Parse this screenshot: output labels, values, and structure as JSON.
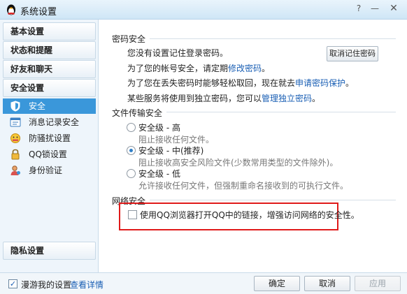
{
  "window": {
    "title": "系统设置",
    "help_label": "?",
    "minimize_label": "—",
    "close_label": "✕"
  },
  "sidebar": {
    "categories": [
      "基本设置",
      "状态和提醒",
      "好友和聊天",
      "安全设置",
      "隐私设置"
    ],
    "security_items": [
      {
        "label": "安全",
        "icon": "shield-icon",
        "active": true
      },
      {
        "label": "消息记录安全",
        "icon": "message-log-icon"
      },
      {
        "label": "防骚扰设置",
        "icon": "anti-harass-icon"
      },
      {
        "label": "QQ锁设置",
        "icon": "lock-icon"
      },
      {
        "label": "身份验证",
        "icon": "identity-icon"
      }
    ]
  },
  "password": {
    "heading": "密码安全",
    "line1": "您没有设置记住登录密码。",
    "cancel_remember_btn": "取消记住密码",
    "line2_prefix": "为了您的帐号安全，请定期",
    "line2_link": "修改密码",
    "line2_suffix": "。",
    "line3_prefix": "为了您在丢失密码时能够轻松取回，现在就去",
    "line3_link": "申请密码保护",
    "line3_suffix": "。",
    "line4_prefix": "某些服务将使用到独立密码，您可以",
    "line4_link": "管理独立密码",
    "line4_suffix": "。"
  },
  "file_transfer": {
    "heading": "文件传输安全",
    "options": [
      {
        "label": "安全级 - 高",
        "desc": "阻止接收任何文件。",
        "checked": false
      },
      {
        "label": "安全级 - 中(推荐)",
        "desc": "阻止接收高安全风险文件(少数常用类型的文件除外)。",
        "checked": true
      },
      {
        "label": "安全级 - 低",
        "desc": "允许接收任何文件，但强制重命名接收到的可执行文件。",
        "checked": false
      }
    ]
  },
  "network": {
    "heading": "网络安全",
    "checkbox_label": "使用QQ浏览器打开QQ中的链接，增强访问网络的安全性。",
    "checked": false
  },
  "bottom": {
    "roam_label": "漫游我的设置",
    "roam_checked": true,
    "details_link": "查看详情",
    "ok": "确定",
    "cancel": "取消",
    "apply": "应用"
  },
  "colors": {
    "accent": "#3a97da",
    "link": "#1a5fb4",
    "highlight_box": "#e01a1a"
  }
}
